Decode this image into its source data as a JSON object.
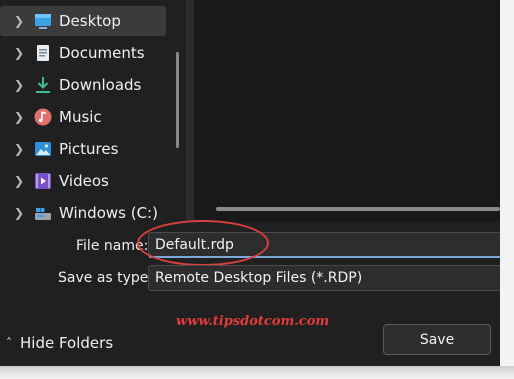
{
  "nav": {
    "items": [
      {
        "label": "Desktop",
        "icon": "desktop-icon"
      },
      {
        "label": "Documents",
        "icon": "documents-icon"
      },
      {
        "label": "Downloads",
        "icon": "downloads-icon"
      },
      {
        "label": "Music",
        "icon": "music-icon"
      },
      {
        "label": "Pictures",
        "icon": "pictures-icon"
      },
      {
        "label": "Videos",
        "icon": "videos-icon"
      },
      {
        "label": "Windows (C:)",
        "icon": "drive-icon"
      }
    ],
    "selected": "Desktop"
  },
  "form": {
    "filename_label": "File name:",
    "filename_value": "Default.rdp",
    "savetype_label": "Save as type:",
    "savetype_value": "Remote Desktop Files (*.RDP)"
  },
  "footer": {
    "hide_folders_label": "Hide Folders",
    "save_label": "Save",
    "watermark": "www.tipsdotcom.com"
  },
  "colors": {
    "background": "#202020",
    "highlight_oval": "#d94040",
    "watermark": "#e33b3b",
    "focus_underline": "#7aa8d8"
  }
}
